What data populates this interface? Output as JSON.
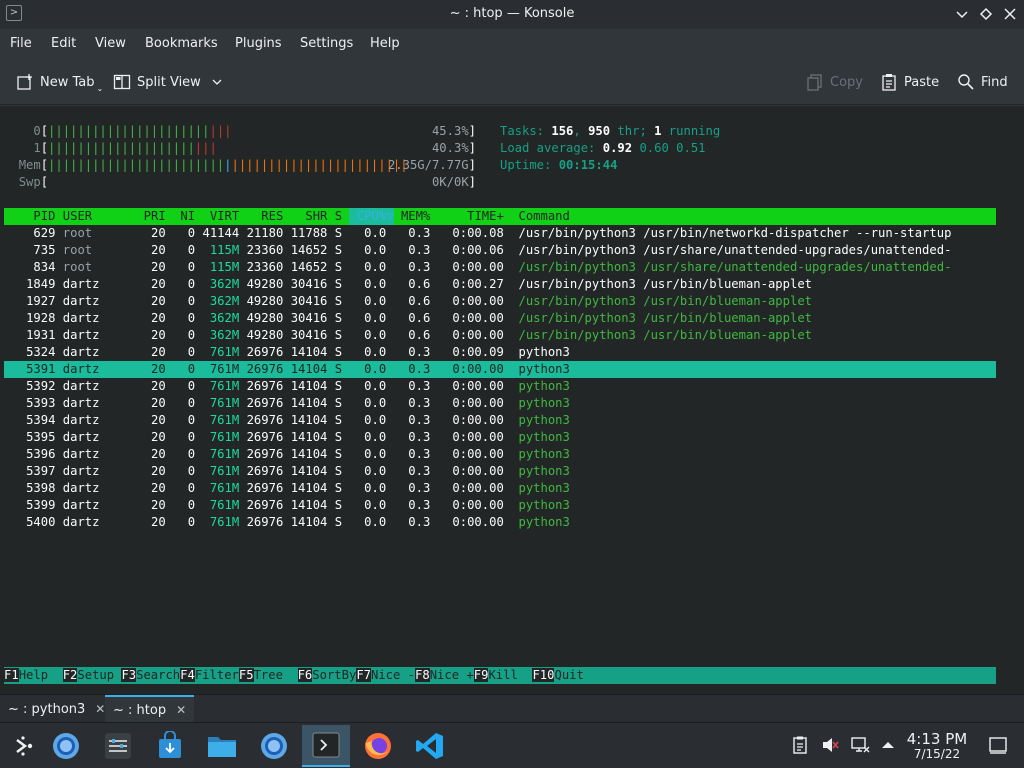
{
  "window": {
    "title": "~ : htop — Konsole"
  },
  "menu": [
    "File",
    "Edit",
    "View",
    "Bookmarks",
    "Plugins",
    "Settings",
    "Help"
  ],
  "toolbar": {
    "new_tab": "New Tab",
    "split_view": "Split View",
    "copy": "Copy",
    "paste": "Paste",
    "find": "Find"
  },
  "htop": {
    "cpu0": {
      "label": "0",
      "bar_green": "||||||||||||||||||||||",
      "bar_red": "|||",
      "percent": "45.3%"
    },
    "cpu1": {
      "label": "1",
      "bar_green": "||||||||||||||||||||",
      "bar_red": "|||",
      "percent": "40.3%"
    },
    "mem": {
      "label": "Mem",
      "bar_green": "||||||||||||||||||||||||",
      "bar_blue": "|",
      "bar_orange": "||||||||||||||||||||||||",
      "value": "2.35G/7.77G"
    },
    "swp": {
      "label": "Swp",
      "value": "0K/0K"
    },
    "tasks": {
      "label": "Tasks: ",
      "count": "156",
      "sep": ", ",
      "thr": "950",
      "thr_label": " thr; ",
      "running": "1",
      "running_label": " running"
    },
    "load": {
      "label": "Load average: ",
      "one": "0.92",
      "five": "0.60",
      "fifteen": "0.51"
    },
    "uptime": {
      "label": "Uptime: ",
      "value": "00:15:44"
    },
    "columns": {
      "pid": "PID",
      "user": "USER",
      "pri": "PRI",
      "ni": "NI",
      "virt": "VIRT",
      "res": "RES",
      "shr": "SHR",
      "s": "S",
      "cpu": "CPU%▽",
      "mem": "MEM%",
      "time": "TIME+",
      "command": "Command"
    },
    "processes": [
      {
        "pid": "629",
        "user": "root",
        "pri": "20",
        "ni": "0",
        "virt": "41144",
        "res": "21180",
        "shr": "11788",
        "s": "S",
        "cpu": "0.0",
        "mem": "0.3",
        "time": "0:00.08",
        "command": "/usr/bin/python3 /usr/bin/networkd-dispatcher --run-startup"
      },
      {
        "pid": "735",
        "user": "root",
        "pri": "20",
        "ni": "0",
        "virt": "115M",
        "res": "23360",
        "shr": "14652",
        "s": "S",
        "cpu": "0.0",
        "mem": "0.3",
        "time": "0:00.06",
        "command": "/usr/bin/python3 /usr/share/unattended-upgrades/unattended-"
      },
      {
        "pid": "834",
        "user": "root",
        "pri": "20",
        "ni": "0",
        "virt": "115M",
        "res": "23360",
        "shr": "14652",
        "s": "S",
        "cpu": "0.0",
        "mem": "0.3",
        "time": "0:00.00",
        "command": "/usr/bin/python3 /usr/share/unattended-upgrades/unattended-",
        "thread": true
      },
      {
        "pid": "1849",
        "user": "dartz",
        "pri": "20",
        "ni": "0",
        "virt": "362M",
        "res": "49280",
        "shr": "30416",
        "s": "S",
        "cpu": "0.0",
        "mem": "0.6",
        "time": "0:00.27",
        "command": "/usr/bin/python3 /usr/bin/blueman-applet"
      },
      {
        "pid": "1927",
        "user": "dartz",
        "pri": "20",
        "ni": "0",
        "virt": "362M",
        "res": "49280",
        "shr": "30416",
        "s": "S",
        "cpu": "0.0",
        "mem": "0.6",
        "time": "0:00.00",
        "command": "/usr/bin/python3 /usr/bin/blueman-applet",
        "thread": true
      },
      {
        "pid": "1928",
        "user": "dartz",
        "pri": "20",
        "ni": "0",
        "virt": "362M",
        "res": "49280",
        "shr": "30416",
        "s": "S",
        "cpu": "0.0",
        "mem": "0.6",
        "time": "0:00.00",
        "command": "/usr/bin/python3 /usr/bin/blueman-applet",
        "thread": true
      },
      {
        "pid": "1931",
        "user": "dartz",
        "pri": "20",
        "ni": "0",
        "virt": "362M",
        "res": "49280",
        "shr": "30416",
        "s": "S",
        "cpu": "0.0",
        "mem": "0.6",
        "time": "0:00.00",
        "command": "/usr/bin/python3 /usr/bin/blueman-applet",
        "thread": true
      },
      {
        "pid": "5324",
        "user": "dartz",
        "pri": "20",
        "ni": "0",
        "virt": "761M",
        "res": "26976",
        "shr": "14104",
        "s": "S",
        "cpu": "0.0",
        "mem": "0.3",
        "time": "0:00.09",
        "command": "python3"
      },
      {
        "pid": "5391",
        "user": "dartz",
        "pri": "20",
        "ni": "0",
        "virt": "761M",
        "res": "26976",
        "shr": "14104",
        "s": "S",
        "cpu": "0.0",
        "mem": "0.3",
        "time": "0:00.00",
        "command": "python3",
        "selected": true
      },
      {
        "pid": "5392",
        "user": "dartz",
        "pri": "20",
        "ni": "0",
        "virt": "761M",
        "res": "26976",
        "shr": "14104",
        "s": "S",
        "cpu": "0.0",
        "mem": "0.3",
        "time": "0:00.00",
        "command": "python3",
        "thread": true
      },
      {
        "pid": "5393",
        "user": "dartz",
        "pri": "20",
        "ni": "0",
        "virt": "761M",
        "res": "26976",
        "shr": "14104",
        "s": "S",
        "cpu": "0.0",
        "mem": "0.3",
        "time": "0:00.00",
        "command": "python3",
        "thread": true
      },
      {
        "pid": "5394",
        "user": "dartz",
        "pri": "20",
        "ni": "0",
        "virt": "761M",
        "res": "26976",
        "shr": "14104",
        "s": "S",
        "cpu": "0.0",
        "mem": "0.3",
        "time": "0:00.00",
        "command": "python3",
        "thread": true
      },
      {
        "pid": "5395",
        "user": "dartz",
        "pri": "20",
        "ni": "0",
        "virt": "761M",
        "res": "26976",
        "shr": "14104",
        "s": "S",
        "cpu": "0.0",
        "mem": "0.3",
        "time": "0:00.00",
        "command": "python3",
        "thread": true
      },
      {
        "pid": "5396",
        "user": "dartz",
        "pri": "20",
        "ni": "0",
        "virt": "761M",
        "res": "26976",
        "shr": "14104",
        "s": "S",
        "cpu": "0.0",
        "mem": "0.3",
        "time": "0:00.00",
        "command": "python3",
        "thread": true
      },
      {
        "pid": "5397",
        "user": "dartz",
        "pri": "20",
        "ni": "0",
        "virt": "761M",
        "res": "26976",
        "shr": "14104",
        "s": "S",
        "cpu": "0.0",
        "mem": "0.3",
        "time": "0:00.00",
        "command": "python3",
        "thread": true
      },
      {
        "pid": "5398",
        "user": "dartz",
        "pri": "20",
        "ni": "0",
        "virt": "761M",
        "res": "26976",
        "shr": "14104",
        "s": "S",
        "cpu": "0.0",
        "mem": "0.3",
        "time": "0:00.00",
        "command": "python3",
        "thread": true
      },
      {
        "pid": "5399",
        "user": "dartz",
        "pri": "20",
        "ni": "0",
        "virt": "761M",
        "res": "26976",
        "shr": "14104",
        "s": "S",
        "cpu": "0.0",
        "mem": "0.3",
        "time": "0:00.00",
        "command": "python3",
        "thread": true
      },
      {
        "pid": "5400",
        "user": "dartz",
        "pri": "20",
        "ni": "0",
        "virt": "761M",
        "res": "26976",
        "shr": "14104",
        "s": "S",
        "cpu": "0.0",
        "mem": "0.3",
        "time": "0:00.00",
        "command": "python3",
        "thread": true
      }
    ],
    "function_keys": [
      {
        "key": "F1",
        "label": "Help  "
      },
      {
        "key": "F2",
        "label": "Setup "
      },
      {
        "key": "F3",
        "label": "Search"
      },
      {
        "key": "F4",
        "label": "Filter"
      },
      {
        "key": "F5",
        "label": "Tree  "
      },
      {
        "key": "F6",
        "label": "SortBy"
      },
      {
        "key": "F7",
        "label": "Nice -"
      },
      {
        "key": "F8",
        "label": "Nice +"
      },
      {
        "key": "F9",
        "label": "Kill  "
      },
      {
        "key": "F10",
        "label": "Quit"
      }
    ]
  },
  "tabs": [
    {
      "label": "~ : python3",
      "active": false
    },
    {
      "label": "~ : htop",
      "active": true
    }
  ],
  "panel": {
    "tasks": [
      "application-launcher-icon",
      "browser-icon",
      "system-settings-icon",
      "discover-store-icon",
      "file-manager-icon",
      "browser-icon",
      "konsole-icon",
      "firefox-icon",
      "vscode-icon"
    ],
    "clock": {
      "time": "4:13 PM",
      "date": "7/15/22"
    }
  },
  "colors": {
    "accent": "#3daee9",
    "header_bar": "#11d116",
    "selected_row": "#1abc9c",
    "terminal_bg": "#232627"
  }
}
